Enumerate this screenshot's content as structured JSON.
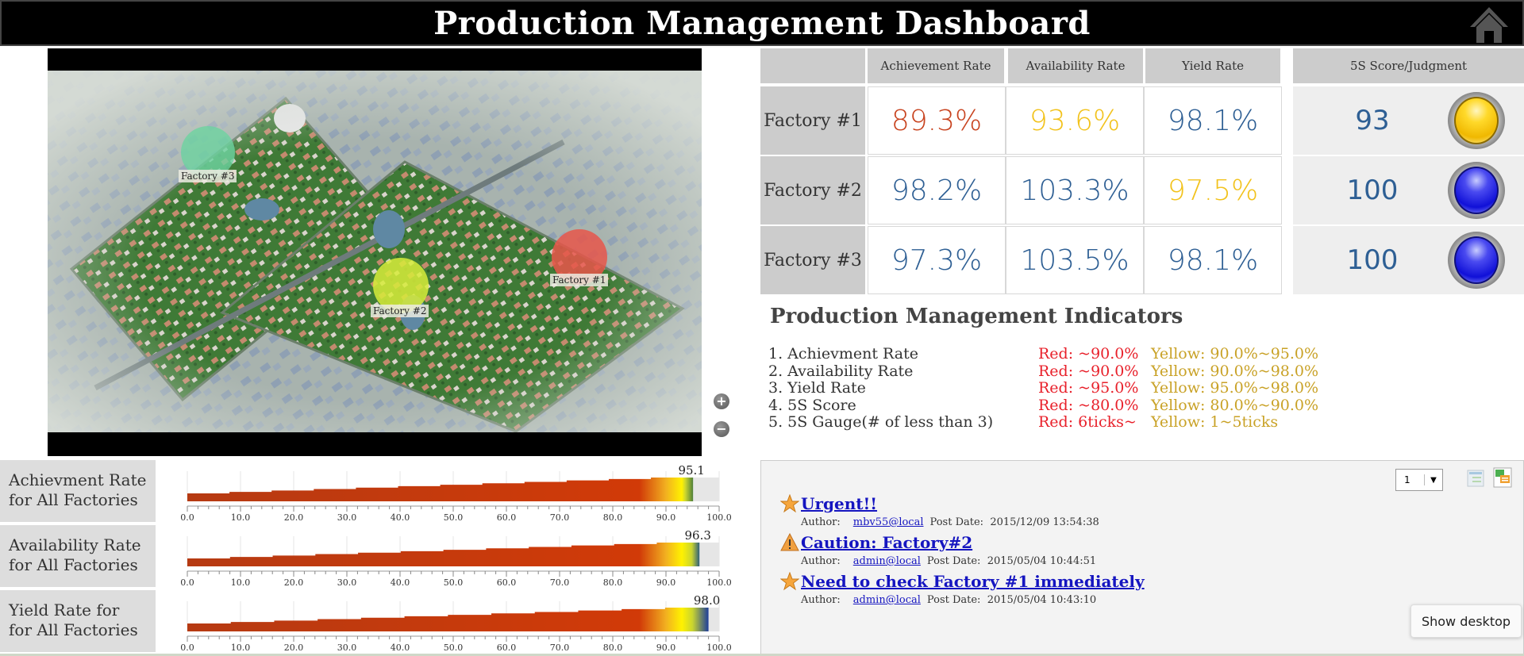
{
  "header": {
    "title": "Production Management Dashboard",
    "home_icon": "home-icon"
  },
  "map": {
    "markers": [
      {
        "label": "Factory #3",
        "status": "green",
        "color": "#6dd3a0"
      },
      {
        "label": "Factory #2",
        "status": "yellow",
        "color": "#d7ec3a"
      },
      {
        "label": "Factory #1",
        "status": "red",
        "color": "#e8564a"
      }
    ],
    "zoom_in": "+",
    "zoom_out": "−"
  },
  "kpi": {
    "headers": [
      "Achievement Rate",
      "Availability Rate",
      "Yield Rate"
    ],
    "s5_header": "5S Score/Judgment",
    "colors": {
      "red": "#c8431f",
      "yellow": "#f2c21b",
      "blue": "#2e5f94"
    },
    "rows": [
      {
        "factory": "Factory #1",
        "achievement": "89.3%",
        "achievement_status": "red",
        "availability": "93.6%",
        "availability_status": "yellow",
        "yield": "98.1%",
        "yield_status": "blue",
        "s5_score": "93",
        "s5_judgment": "yellow"
      },
      {
        "factory": "Factory #2",
        "achievement": "98.2%",
        "achievement_status": "blue",
        "availability": "103.3%",
        "availability_status": "blue",
        "yield": "97.5%",
        "yield_status": "yellow",
        "s5_score": "100",
        "s5_judgment": "blue"
      },
      {
        "factory": "Factory #3",
        "achievement": "97.3%",
        "achievement_status": "blue",
        "availability": "103.5%",
        "availability_status": "blue",
        "yield": "98.1%",
        "yield_status": "blue",
        "s5_score": "100",
        "s5_judgment": "blue"
      }
    ]
  },
  "indicators": {
    "title": "Production Management Indicators",
    "items": [
      {
        "name": "1.  Achievment Rate",
        "red": "Red: ~90.0%",
        "yellow": "Yellow:  90.0%~95.0%"
      },
      {
        "name": "2.  Availability Rate",
        "red": "Red: ~90.0%",
        "yellow": "Yellow:  90.0%~98.0%"
      },
      {
        "name": "3.  Yield Rate",
        "red": "Red: ~95.0%",
        "yellow": "Yellow:  95.0%~98.0%"
      },
      {
        "name": "4.  5S Score",
        "red": "Red: ~80.0%",
        "yellow": "Yellow:  80.0%~90.0%"
      },
      {
        "name": "5.  5S Gauge(# of less than 3)",
        "red": "Red: 6ticks~",
        "yellow": "Yellow:  1~5ticks"
      }
    ]
  },
  "gauges": {
    "ticks": [
      "0.0",
      "10.0",
      "20.0",
      "30.0",
      "40.0",
      "50.0",
      "60.0",
      "70.0",
      "80.0",
      "90.0",
      "100.0"
    ],
    "min": 0,
    "max": 100,
    "items": [
      {
        "label_line1": "Achievment Rate",
        "label_line2": "for All Factories",
        "value": 95.1,
        "value_label": "95.1",
        "end_color": "#4f7f3a"
      },
      {
        "label_line1": "Availability Rate",
        "label_line2": "for All Factories",
        "value": 96.3,
        "value_label": "96.3",
        "end_color": "#2f5f7a"
      },
      {
        "label_line1": "Yield Rate for",
        "label_line2": "for All Factories",
        "value": 98.0,
        "value_label": "98.0",
        "end_color": "#1e3f9a"
      }
    ]
  },
  "posts": {
    "page_select": "1",
    "author_label": "Author:",
    "date_label": "Post Date:",
    "items": [
      {
        "icon": "star-icon",
        "title": "Urgent!!",
        "author": "mbv55@local",
        "date": "2015/12/09 13:54:38"
      },
      {
        "icon": "warning-icon",
        "title": "Caution: Factory#2",
        "author": "admin@local",
        "date": "2015/05/04 10:44:51"
      },
      {
        "icon": "star-icon",
        "title": "Need to check Factory #1 immediately",
        "author": "admin@local",
        "date": "2015/05/04 10:43:10"
      }
    ]
  },
  "tooltip": {
    "text": "Show desktop"
  }
}
